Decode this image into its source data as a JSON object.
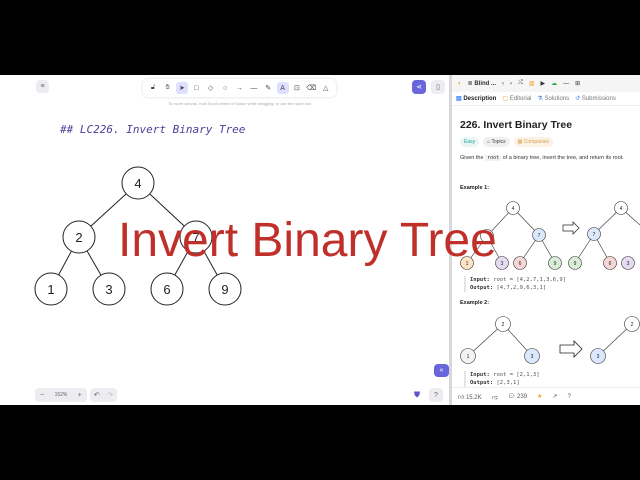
{
  "canvas": {
    "heading": "## LC226. Invert Binary Tree",
    "hint": "To move canvas, hold Scroll wheel or Space while dragging, or use the hand tool",
    "zoom": "152%",
    "tree": {
      "root": "4",
      "l": "2",
      "r": "7",
      "ll": "1",
      "lr": "3",
      "rl": "6",
      "rr": "9"
    }
  },
  "overlay": "Invert Binary Tree",
  "panel": {
    "list_name": "Blind ...",
    "tabs": [
      "Description",
      "Editorial",
      "Solutions",
      "Submissions"
    ],
    "title": "226. Invert Binary Tree",
    "difficulty": "Easy",
    "topics": "Topics",
    "companies": "Companies",
    "desc_pre": "Given the ",
    "desc_code": "root",
    "desc_post": " of a binary tree, invert the tree, and return its root.",
    "ex1_label": "Example 1:",
    "ex1_input": "root = [4,2,7,1,3,6,9]",
    "ex1_output": "[4,7,2,9,6,3,1]",
    "ex2_label": "Example 2:",
    "ex2_input": "root = [2,1,3]",
    "ex2_output": "[2,3,1]",
    "input_label": "Input:",
    "output_label": "Output:",
    "likes": "15.2K",
    "comments": "239"
  }
}
